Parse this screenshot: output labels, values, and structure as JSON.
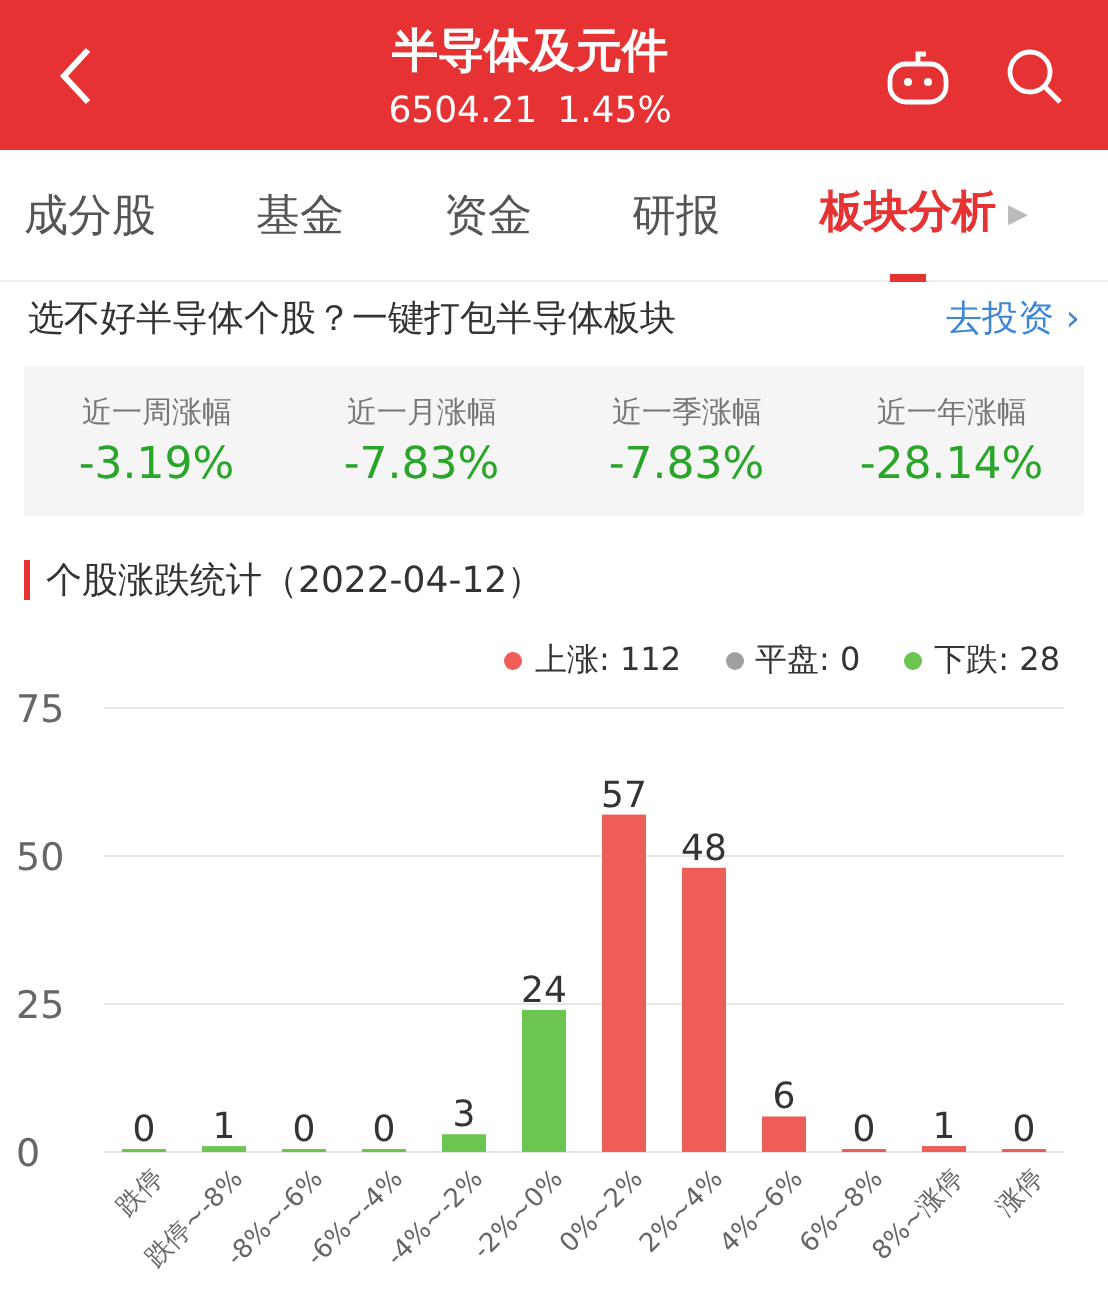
{
  "header": {
    "title": "半导体及元件",
    "price": "6504.21",
    "change": "1.45%"
  },
  "tabs": [
    {
      "label": "成分股",
      "selected": false
    },
    {
      "label": "基金",
      "selected": false
    },
    {
      "label": "资金",
      "selected": false
    },
    {
      "label": "研报",
      "selected": false
    },
    {
      "label": "板块分析",
      "selected": true
    }
  ],
  "tabs_more": "▶",
  "promo": {
    "text": "选不好半导体个股？一键打包半导体板块",
    "link": "去投资",
    "arrow": "›"
  },
  "stats": [
    {
      "label": "近一周涨幅",
      "value": "-3.19%"
    },
    {
      "label": "近一月涨幅",
      "value": "-7.83%"
    },
    {
      "label": "近一季涨幅",
      "value": "-7.83%"
    },
    {
      "label": "近一年涨幅",
      "value": "-28.14%"
    }
  ],
  "section": {
    "title": "个股涨跌统计（2022-04-12）"
  },
  "legend": [
    {
      "label": "上涨: 112",
      "color": "#ef5d58"
    },
    {
      "label": "平盘: 0",
      "color": "#a0a0a0"
    },
    {
      "label": "下跌: 28",
      "color": "#6cc551"
    }
  ],
  "chart": {
    "chart_data": {
      "type": "bar",
      "data_labels": true,
      "categories": [
        "跌停",
        "跌停~-8%",
        "-8%~-6%",
        "-6%~-4%",
        "-4%~-2%",
        "-2%~0%",
        "0%~2%",
        "2%~4%",
        "4%~6%",
        "6%~8%",
        "8%~涨停",
        "涨停"
      ],
      "series": [
        {
          "color": "#6cc551",
          "values": [
            0,
            1,
            0,
            0,
            3,
            24,
            null,
            null,
            null,
            null,
            null,
            null
          ]
        },
        {
          "color": "#ef5d58",
          "values": [
            null,
            null,
            null,
            null,
            null,
            null,
            57,
            48,
            6,
            0,
            1,
            0
          ]
        }
      ],
      "ylim": [
        0,
        75
      ],
      "yticks": [
        0,
        25,
        50,
        75
      ]
    }
  }
}
